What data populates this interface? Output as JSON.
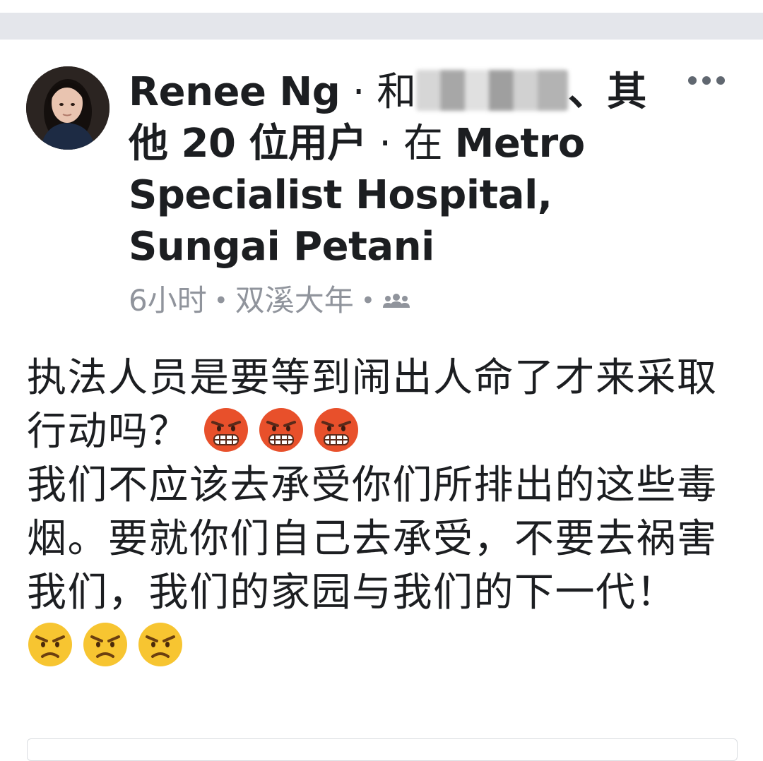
{
  "header": {
    "author": "Renee Ng",
    "sep1": " · ",
    "with_word": "和",
    "tagged_names": "",
    "enum_sep": "、",
    "others_count": "其他 20 位用户",
    "sep2": " · ",
    "at_word": "在 ",
    "location": "Metro Specialist Hospital, Sungai Petani"
  },
  "meta": {
    "time": "6小时",
    "dot1": "•",
    "place": "双溪大年",
    "dot2": "•",
    "audience_icon": "friends-icon"
  },
  "post": {
    "paragraph1": "执法人员是要等到闹出人命了才来采取行动吗？",
    "paragraph1_emojis": [
      "steam-from-nose-emoji",
      "steam-from-nose-emoji",
      "steam-from-nose-emoji"
    ],
    "paragraph2": "我们不应该去承受你们所排出的这些毒烟。要就你们自己去承受，不要去祸害我们，我们的家园与我们的下一代！",
    "paragraph2_emojis": [
      "angry-face-emoji",
      "angry-face-emoji",
      "angry-face-emoji"
    ]
  },
  "icons": {
    "more": "more-options-icon",
    "avatar": "profile-avatar"
  },
  "colors": {
    "text": "#1c1e21",
    "meta": "#90949c",
    "divider": "#e4e6eb",
    "emoji_red": "#e8502b",
    "emoji_yellow": "#f7c531"
  }
}
